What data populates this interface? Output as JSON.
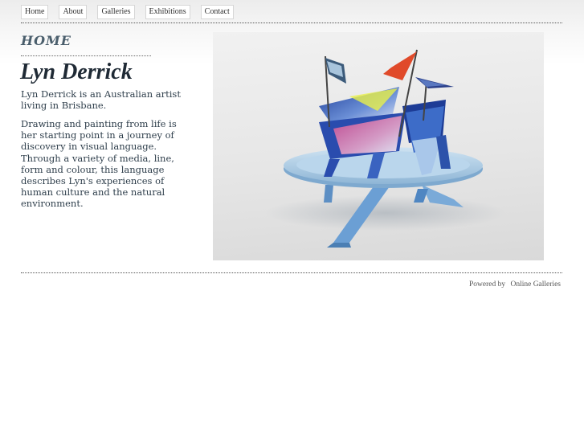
{
  "nav": {
    "items": [
      {
        "label": "Home"
      },
      {
        "label": "About"
      },
      {
        "label": "Galleries"
      },
      {
        "label": "Exhibitions"
      },
      {
        "label": "Contact"
      }
    ]
  },
  "main": {
    "page_heading": "HOME",
    "artist_name": "Lyn Derrick",
    "intro": "Lyn Derrick is an Australian artist living in Brisbane.",
    "description": "Drawing and painting from life is her starting point in a journey of discovery in visual language. Through a variety of media, line, form and colour, this language describes Lyn's experiences of human culture and the natural environment."
  },
  "footer": {
    "powered_by": "Powered by",
    "link_label": "Online Galleries"
  },
  "colors": {
    "heading": "#4a5e6c",
    "name": "#1f2a35",
    "body_text": "#2e3e4b",
    "nav_border": "#d6d6d6"
  }
}
